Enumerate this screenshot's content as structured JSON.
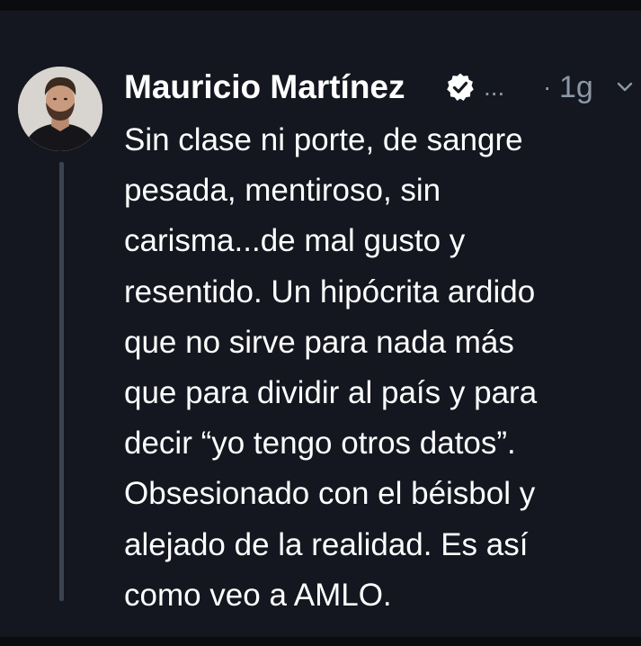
{
  "tweet": {
    "author": {
      "display_name": "Mauricio Martínez",
      "handle_truncated": "...",
      "verified": true,
      "avatar_icon": "profile-photo"
    },
    "separator": "·",
    "timestamp": "1g",
    "menu_icon": "chevron-down-icon",
    "lines": [
      "Sin clase ni porte, de sangre",
      "pesada, mentiroso, sin",
      "carisma...de mal gusto y",
      "resentido. Un hipócrita ardido",
      "que no sirve para nada más",
      "que para dividir al país y para",
      "decir “yo tengo otros datos”.",
      "Obsesionado con el béisbol y",
      "alejado de la realidad. Es así",
      "como veo a AMLO."
    ]
  },
  "colors": {
    "background": "#14171f",
    "text": "#ffffff",
    "secondary_text": "#8b98a5",
    "thread_line": "#3a4350"
  }
}
